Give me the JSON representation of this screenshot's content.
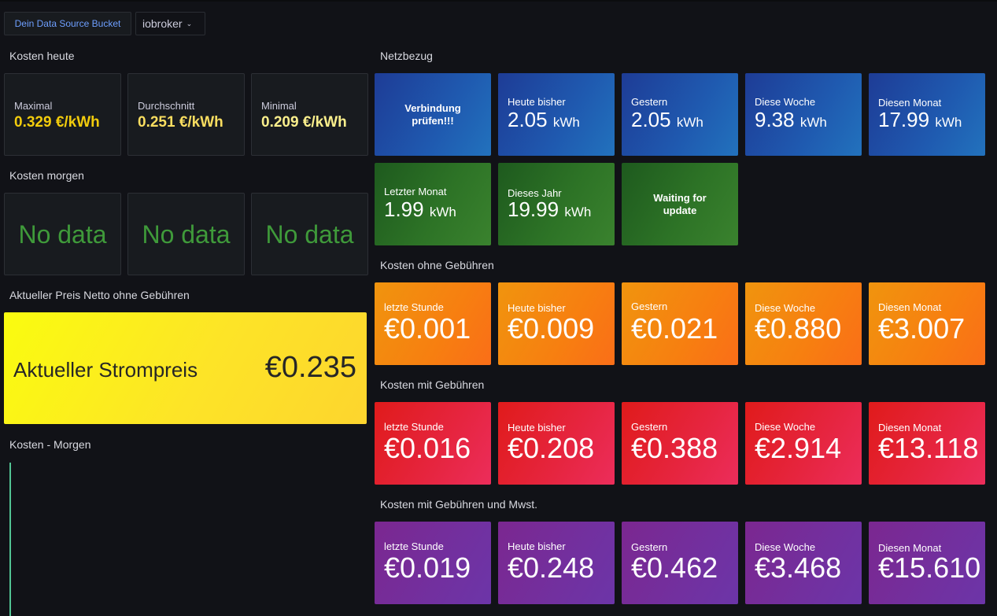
{
  "variables": {
    "bucket_label": "Dein Data Source Bucket",
    "bucket_value": "iobroker",
    "chevron_icon": "chevron-down-icon"
  },
  "kosten_heute": {
    "title": "Kosten heute",
    "tiles": [
      {
        "label": "Maximal",
        "value": "0.329 €/kWh",
        "color": "#f2cc0c"
      },
      {
        "label": "Durchschnitt",
        "value": "0.251 €/kWh",
        "color": "#fade60"
      },
      {
        "label": "Minimal",
        "value": "0.209 €/kWh",
        "color": "#faef8c"
      }
    ]
  },
  "kosten_morgen": {
    "title": "Kosten morgen",
    "tiles": [
      {
        "value": "No data"
      },
      {
        "value": "No data"
      },
      {
        "value": "No data"
      }
    ]
  },
  "aktueller_preis": {
    "title": "Aktueller Preis Netto ohne Gebühren",
    "label": "Aktueller Strompreis",
    "value": "€0.235"
  },
  "kosten_morgen_chart": {
    "title": "Kosten - Morgen"
  },
  "netzbezug": {
    "title": "Netzbezug",
    "row1": [
      {
        "message": "Verbindung prüfen!!!"
      },
      {
        "label": "Heute bisher",
        "value": "2.05",
        "unit": "kWh"
      },
      {
        "label": "Gestern",
        "value": "2.05",
        "unit": "kWh"
      },
      {
        "label": "Diese Woche",
        "value": "9.38",
        "unit": "kWh"
      },
      {
        "label": "Diesen Monat",
        "value": "17.99",
        "unit": "kWh"
      }
    ],
    "row2": [
      {
        "label": "Letzter Monat",
        "value": "1.99",
        "unit": "kWh"
      },
      {
        "label": "Dieses Jahr",
        "value": "19.99",
        "unit": "kWh"
      },
      {
        "message": "Waiting for update"
      }
    ]
  },
  "kosten_ohne": {
    "title": "Kosten ohne Gebühren",
    "tiles": [
      {
        "label": "letzte Stunde",
        "value": "€0.001"
      },
      {
        "label": "Heute bisher",
        "value": "€0.009"
      },
      {
        "label": "Gestern",
        "value": "€0.021"
      },
      {
        "label": "Diese Woche",
        "value": "€0.880"
      },
      {
        "label": "Diesen Monat",
        "value": "€3.007"
      }
    ]
  },
  "kosten_mit": {
    "title": "Kosten mit Gebühren",
    "tiles": [
      {
        "label": "letzte Stunde",
        "value": "€0.016"
      },
      {
        "label": "Heute bisher",
        "value": "€0.208"
      },
      {
        "label": "Gestern",
        "value": "€0.388"
      },
      {
        "label": "Diese Woche",
        "value": "€2.914"
      },
      {
        "label": "Diesen Monat",
        "value": "€13.118"
      }
    ]
  },
  "kosten_mit_mwst": {
    "title": "Kosten mit Gebühren und Mwst.",
    "tiles": [
      {
        "label": "letzte Stunde",
        "value": "€0.019"
      },
      {
        "label": "Heute bisher",
        "value": "€0.248"
      },
      {
        "label": "Gestern",
        "value": "€0.462"
      },
      {
        "label": "Diese Woche",
        "value": "€3.468"
      },
      {
        "label": "Diesen Monat",
        "value": "€15.610"
      }
    ]
  }
}
